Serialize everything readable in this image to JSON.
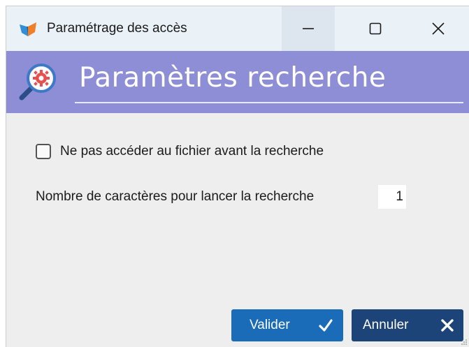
{
  "window": {
    "title": "Paramétrage des accès"
  },
  "header": {
    "title": "Paramètres recherche",
    "icon": "search-settings-icon"
  },
  "options": {
    "skip_file_access_label": "Ne pas accéder au fichier avant la recherche",
    "skip_file_access_checked": false,
    "char_count_label": "Nombre de caractères pour lancer la recherche",
    "char_count_value": "1"
  },
  "buttons": {
    "validate_label": "Valider",
    "cancel_label": "Annuler"
  },
  "colors": {
    "header_bg": "#8d8ed6",
    "validate_bg": "#1a6bb8",
    "cancel_bg": "#1d4478"
  }
}
